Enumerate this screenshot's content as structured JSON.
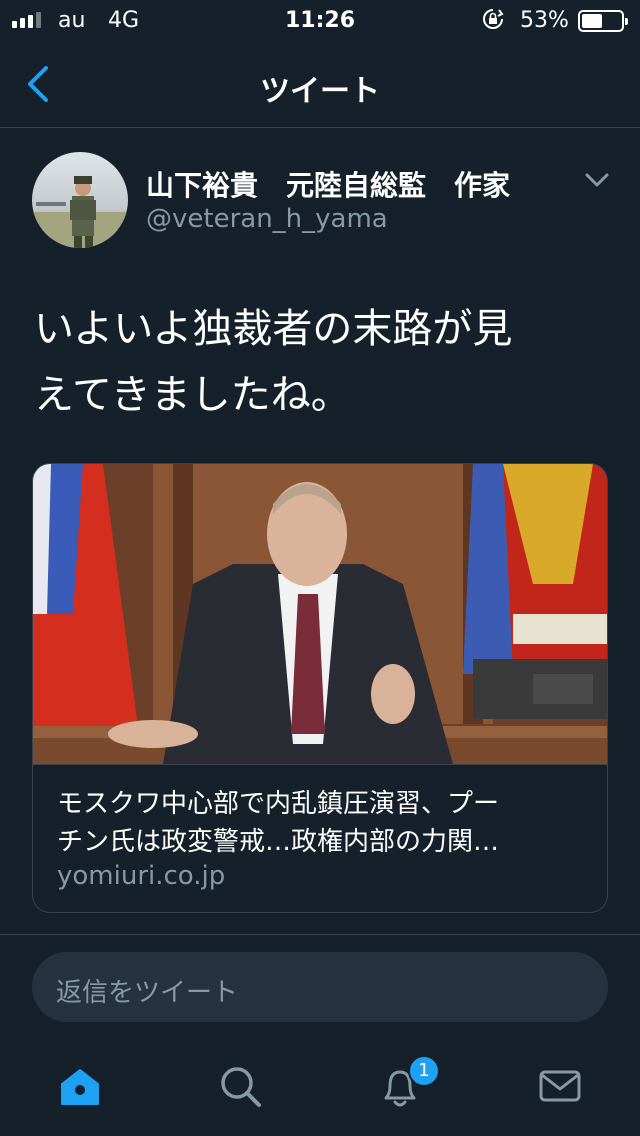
{
  "status_bar": {
    "carrier": "au",
    "network": "4G",
    "time": "11:26",
    "battery_percent": "53%",
    "battery_level": 0.53
  },
  "nav": {
    "title": "ツイート",
    "back_icon": "chevron-left-icon"
  },
  "tweet": {
    "display_name": "山下裕貴　元陸自総監　作家",
    "handle": "@veteran_h_yama",
    "text_line1": "いよいよ独裁者の末路が見",
    "text_line2": "えてきましたね。"
  },
  "link_card": {
    "title_line1": "モスクワ中心部で内乱鎮圧演習、プー",
    "title_line2": "チン氏は政変警戒…政権内部の力関…",
    "domain": "yomiuri.co.jp"
  },
  "reply": {
    "placeholder": "返信をツイート"
  },
  "tab_bar": {
    "items": [
      "home-icon",
      "search-icon",
      "notifications-icon",
      "messages-icon"
    ],
    "notification_count": "1"
  },
  "colors": {
    "background": "#15202b",
    "accent": "#1da1f2",
    "secondary_text": "#8899a6",
    "border": "#38444d"
  }
}
